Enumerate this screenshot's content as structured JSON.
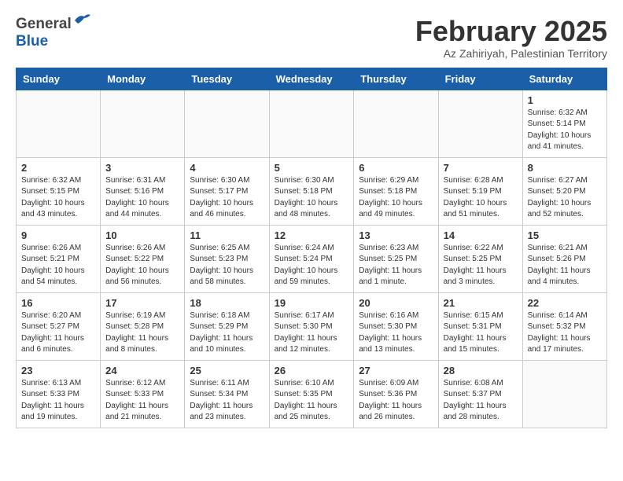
{
  "header": {
    "logo_general": "General",
    "logo_blue": "Blue",
    "month": "February 2025",
    "location": "Az Zahiriyah, Palestinian Territory"
  },
  "days_of_week": [
    "Sunday",
    "Monday",
    "Tuesday",
    "Wednesday",
    "Thursday",
    "Friday",
    "Saturday"
  ],
  "weeks": [
    [
      {
        "day": "",
        "info": ""
      },
      {
        "day": "",
        "info": ""
      },
      {
        "day": "",
        "info": ""
      },
      {
        "day": "",
        "info": ""
      },
      {
        "day": "",
        "info": ""
      },
      {
        "day": "",
        "info": ""
      },
      {
        "day": "1",
        "info": "Sunrise: 6:32 AM\nSunset: 5:14 PM\nDaylight: 10 hours\nand 41 minutes."
      }
    ],
    [
      {
        "day": "2",
        "info": "Sunrise: 6:32 AM\nSunset: 5:15 PM\nDaylight: 10 hours\nand 43 minutes."
      },
      {
        "day": "3",
        "info": "Sunrise: 6:31 AM\nSunset: 5:16 PM\nDaylight: 10 hours\nand 44 minutes."
      },
      {
        "day": "4",
        "info": "Sunrise: 6:30 AM\nSunset: 5:17 PM\nDaylight: 10 hours\nand 46 minutes."
      },
      {
        "day": "5",
        "info": "Sunrise: 6:30 AM\nSunset: 5:18 PM\nDaylight: 10 hours\nand 48 minutes."
      },
      {
        "day": "6",
        "info": "Sunrise: 6:29 AM\nSunset: 5:18 PM\nDaylight: 10 hours\nand 49 minutes."
      },
      {
        "day": "7",
        "info": "Sunrise: 6:28 AM\nSunset: 5:19 PM\nDaylight: 10 hours\nand 51 minutes."
      },
      {
        "day": "8",
        "info": "Sunrise: 6:27 AM\nSunset: 5:20 PM\nDaylight: 10 hours\nand 52 minutes."
      }
    ],
    [
      {
        "day": "9",
        "info": "Sunrise: 6:26 AM\nSunset: 5:21 PM\nDaylight: 10 hours\nand 54 minutes."
      },
      {
        "day": "10",
        "info": "Sunrise: 6:26 AM\nSunset: 5:22 PM\nDaylight: 10 hours\nand 56 minutes."
      },
      {
        "day": "11",
        "info": "Sunrise: 6:25 AM\nSunset: 5:23 PM\nDaylight: 10 hours\nand 58 minutes."
      },
      {
        "day": "12",
        "info": "Sunrise: 6:24 AM\nSunset: 5:24 PM\nDaylight: 10 hours\nand 59 minutes."
      },
      {
        "day": "13",
        "info": "Sunrise: 6:23 AM\nSunset: 5:25 PM\nDaylight: 11 hours\nand 1 minute."
      },
      {
        "day": "14",
        "info": "Sunrise: 6:22 AM\nSunset: 5:25 PM\nDaylight: 11 hours\nand 3 minutes."
      },
      {
        "day": "15",
        "info": "Sunrise: 6:21 AM\nSunset: 5:26 PM\nDaylight: 11 hours\nand 4 minutes."
      }
    ],
    [
      {
        "day": "16",
        "info": "Sunrise: 6:20 AM\nSunset: 5:27 PM\nDaylight: 11 hours\nand 6 minutes."
      },
      {
        "day": "17",
        "info": "Sunrise: 6:19 AM\nSunset: 5:28 PM\nDaylight: 11 hours\nand 8 minutes."
      },
      {
        "day": "18",
        "info": "Sunrise: 6:18 AM\nSunset: 5:29 PM\nDaylight: 11 hours\nand 10 minutes."
      },
      {
        "day": "19",
        "info": "Sunrise: 6:17 AM\nSunset: 5:30 PM\nDaylight: 11 hours\nand 12 minutes."
      },
      {
        "day": "20",
        "info": "Sunrise: 6:16 AM\nSunset: 5:30 PM\nDaylight: 11 hours\nand 13 minutes."
      },
      {
        "day": "21",
        "info": "Sunrise: 6:15 AM\nSunset: 5:31 PM\nDaylight: 11 hours\nand 15 minutes."
      },
      {
        "day": "22",
        "info": "Sunrise: 6:14 AM\nSunset: 5:32 PM\nDaylight: 11 hours\nand 17 minutes."
      }
    ],
    [
      {
        "day": "23",
        "info": "Sunrise: 6:13 AM\nSunset: 5:33 PM\nDaylight: 11 hours\nand 19 minutes."
      },
      {
        "day": "24",
        "info": "Sunrise: 6:12 AM\nSunset: 5:33 PM\nDaylight: 11 hours\nand 21 minutes."
      },
      {
        "day": "25",
        "info": "Sunrise: 6:11 AM\nSunset: 5:34 PM\nDaylight: 11 hours\nand 23 minutes."
      },
      {
        "day": "26",
        "info": "Sunrise: 6:10 AM\nSunset: 5:35 PM\nDaylight: 11 hours\nand 25 minutes."
      },
      {
        "day": "27",
        "info": "Sunrise: 6:09 AM\nSunset: 5:36 PM\nDaylight: 11 hours\nand 26 minutes."
      },
      {
        "day": "28",
        "info": "Sunrise: 6:08 AM\nSunset: 5:37 PM\nDaylight: 11 hours\nand 28 minutes."
      },
      {
        "day": "",
        "info": ""
      }
    ]
  ]
}
